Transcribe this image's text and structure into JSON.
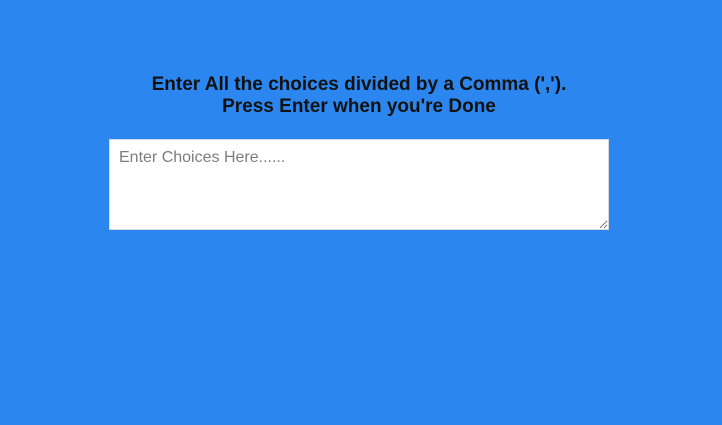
{
  "prompt": {
    "line1": "Enter All the choices divided by a Comma (',').",
    "line2": "Press Enter when you're Done"
  },
  "choices_input": {
    "value": "",
    "placeholder": "Enter Choices Here......"
  },
  "colors": {
    "background": "#2b87ef",
    "text": "#111111",
    "input_background": "#ffffff"
  }
}
